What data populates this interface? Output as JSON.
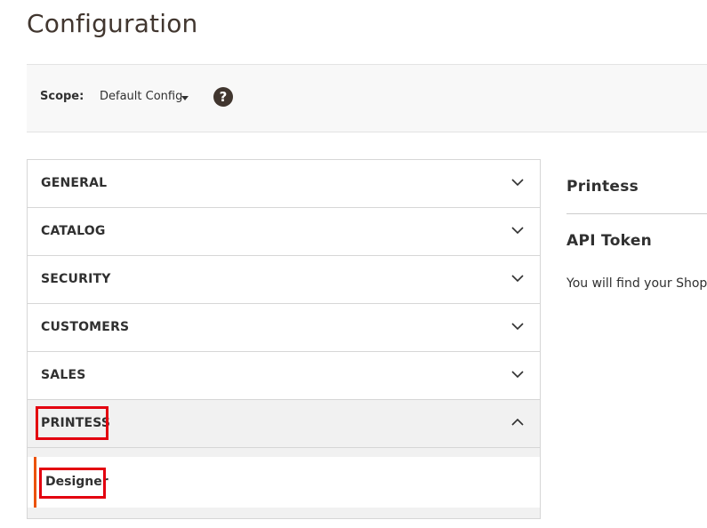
{
  "page": {
    "title": "Configuration"
  },
  "scope": {
    "label": "Scope:",
    "selected": "Default Config",
    "help_icon": "question-icon"
  },
  "tabs": [
    {
      "label": "GENERAL",
      "icon": "chevron-down-icon"
    },
    {
      "label": "CATALOG",
      "icon": "chevron-down-icon"
    },
    {
      "label": "SECURITY",
      "icon": "chevron-down-icon"
    },
    {
      "label": "CUSTOMERS",
      "icon": "chevron-down-icon"
    },
    {
      "label": "SALES",
      "icon": "chevron-down-icon"
    },
    {
      "label": "PRINTESS",
      "icon": "chevron-up-icon",
      "expanded": true
    }
  ],
  "printess_sub": {
    "items": [
      {
        "label": "Designer",
        "active": true
      }
    ]
  },
  "main": {
    "section_title": "Printess",
    "group_title": "API Token",
    "description": "You will find your Shop- a"
  },
  "colors": {
    "highlight": "#e3000f",
    "active_accent": "#eb5202",
    "title": "#41362f"
  }
}
